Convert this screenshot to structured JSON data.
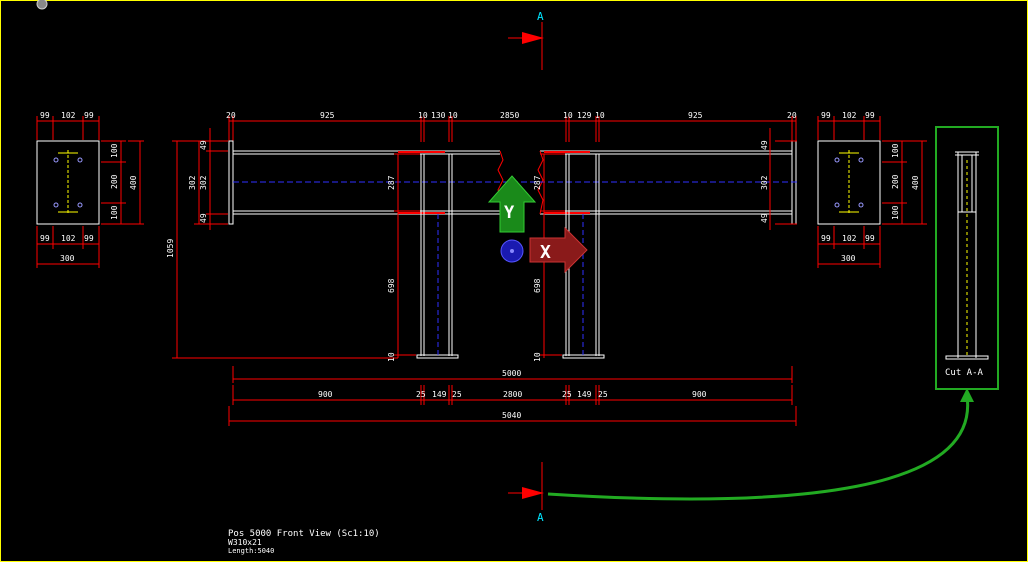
{
  "section_markers": {
    "top": "A",
    "bottom": "A"
  },
  "section_view": {
    "label": "Cut A-A"
  },
  "caption": {
    "title": "Pos 5000 Front View (Sc1:10)",
    "profile": "W310x21",
    "length": "Length:5040"
  },
  "ucs": {
    "y": "Y",
    "x": "X"
  },
  "colors": {
    "frame": "#ffff00",
    "dimension": "#ff0000",
    "member": "#ffffff",
    "centerline": "#3030ff",
    "marker": "#00e5ff",
    "highlight": "#22aa22"
  },
  "dimensions": {
    "top": [
      "20",
      "925",
      "10",
      "130",
      "10",
      "2850",
      "10",
      "129",
      "10",
      "925",
      "20"
    ],
    "left_plate_top": [
      "99",
      "102",
      "99"
    ],
    "left_plate_bottom": [
      "99",
      "102",
      "99"
    ],
    "left_plate_width": "300",
    "left_plate_side": [
      "100",
      "200",
      "100"
    ],
    "left_plate_height": "400",
    "right_plate_top": [
      "99",
      "102",
      "99"
    ],
    "right_plate_bottom": [
      "99",
      "102",
      "99"
    ],
    "right_plate_width": "300",
    "right_plate_side": [
      "100",
      "200",
      "100"
    ],
    "right_plate_height": "400",
    "beam_left": [
      "49",
      "302",
      "49"
    ],
    "beam_left_overall": "302",
    "beam_right": [
      "49",
      "302",
      "49"
    ],
    "overall_height": "1059",
    "inner_depth": [
      "287",
      "287"
    ],
    "leg_length": [
      "698",
      "698"
    ],
    "leg_base": [
      "10",
      "10"
    ],
    "total_5000": "5000",
    "bottom_chain": [
      "900",
      "25",
      "149",
      "25",
      "2800",
      "25",
      "149",
      "25",
      "900"
    ],
    "total_5040": "5040"
  }
}
